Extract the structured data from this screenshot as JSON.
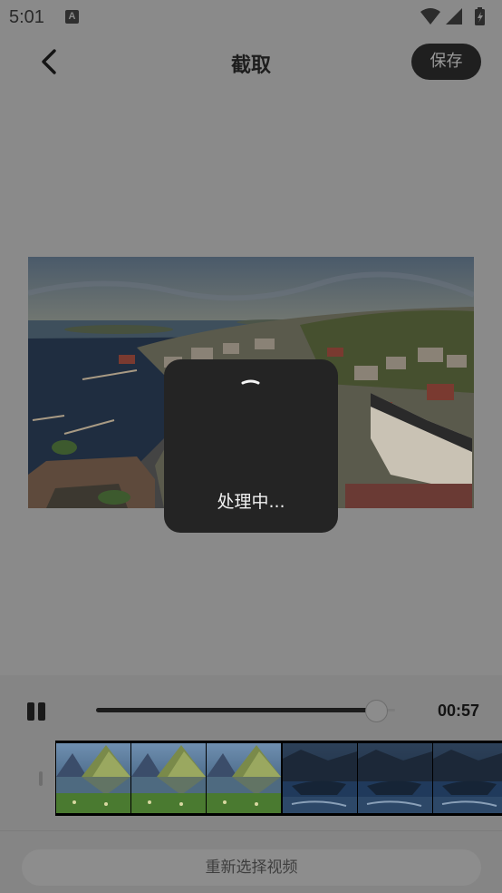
{
  "status_bar": {
    "time": "5:01",
    "notification_badge": "A",
    "icons": [
      "wifi-icon",
      "cell-signal-icon",
      "battery-charging-icon"
    ]
  },
  "header": {
    "title": "截取",
    "save_label": "保存",
    "back_icon": "chevron-left-icon"
  },
  "loading": {
    "text": "处理中..."
  },
  "player": {
    "state": "playing",
    "control_icon": "pause-icon",
    "time": "00:57",
    "progress": 0.95
  },
  "actions": {
    "reselect_label": "重新选择视频"
  },
  "colors": {
    "overlay": "#8a8a8a",
    "save_bg": "#1f1f1f",
    "modal_bg": "#242424",
    "progress_fill": "#1c1c1c"
  }
}
